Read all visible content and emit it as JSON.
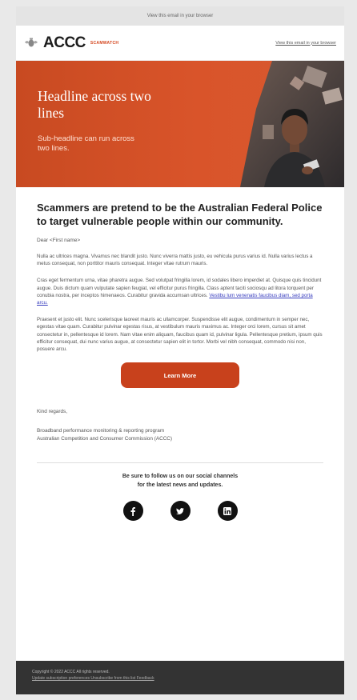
{
  "email": {
    "browser_link_top": "View this email in your browser",
    "browser_link_header": "View this email in your browser",
    "brand": {
      "logo_text": "ACCC",
      "sub_brand": "SCAMWATCH",
      "accent_color": "#c8411c"
    },
    "hero": {
      "headline": "Headline across two lines",
      "subheadline": "Sub-headline can run across two lines."
    },
    "title": "Scammers are pretend to be the Australian Federal Police to target vulnerable people within our community.",
    "greeting": "Dear <First name>",
    "paragraphs": [
      "Nulla ac ultrices magna. Vivamus nec blandit justo. Nunc viverra mattis justo, eu vehicula purus varius id. Nulla varius lectus a metus consequat, non porttitor mauris consequat. Integer vitae rutrum mauris.",
      "Cras eget fermentum urna, vitae pharetra augue. Sed volutpat fringilla lorem, id sodales libero imperdiet at. Quisque quis tincidunt augue. Duis dictum quam vulputate sapien feugiat, vel efficitur purus fringilla. Class aptent taciti sociosqu ad litora torquent per conubia nostra, per inceptos himenaeos. Curabitur gravida accumsan ultrices.",
      "Praesent et justo elit. Nunc scelerisque laoreet mauris ac ullamcorper. Suspendisse elit augue, condimentum in semper nec, egestas vitae quam. Curabitur pulvinar egestas risus, at vestibulum mauris maximus ac. Integer orci lorem, cursus sit amet consectetur in, pellentesque id lorem. Nam vitae enim aliquam, faucibus quam id, pulvinar ligula. Pellentesque pretium, ipsum quis efficitur consequat, dui nunc varius augue, at consectetur sapien elit in tortor. Morbi vel nibh consequat, commodo nisi non, posuere arcu."
    ],
    "inline_link": "Vestibu lum venenatis faucibus diam, sed porta arcu.",
    "cta_label": "Learn More",
    "sign_off": "Kind regards,",
    "signature_line1": "Broadband performance monitoring & reporting program",
    "signature_line2": "Australian Competition and Consumer Commission (ACCC)",
    "social": {
      "line1": "Be sure to follow us on our social channels",
      "line2": "for the latest news and updates.",
      "icons": [
        "facebook-icon",
        "twitter-icon",
        "linkedin-icon"
      ]
    },
    "footer": {
      "copyright": "Copyright © 2022 ACCC All rights reserved.",
      "links": "Update subscription preferences Unsubscribe from this list Feedback"
    }
  }
}
